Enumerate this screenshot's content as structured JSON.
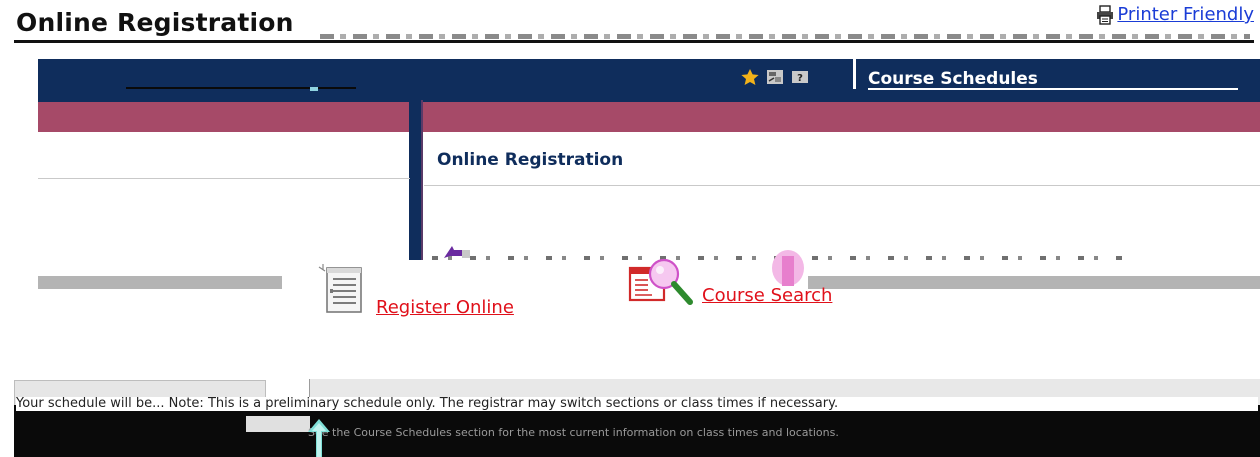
{
  "header": {
    "page_title": "Online Registration",
    "printer_link": "Printer Friendly"
  },
  "nav": {
    "heading": "Course Schedules",
    "tools": [
      {
        "icon": "star-icon",
        "color": "#f2b21a"
      },
      {
        "icon": "settings-icon",
        "color": "#c9c9c9"
      },
      {
        "icon": "help-icon",
        "color": "#c9c9c9"
      }
    ],
    "colors": {
      "navy": "#0f2d5c",
      "maroon": "#a64a68"
    }
  },
  "content": {
    "heading": "Online Registration",
    "actions": [
      {
        "label": " Register Online",
        "icon": "registration-form-icon"
      },
      {
        "label": " Course Search",
        "icon": "magnifier-search-icon"
      }
    ],
    "link_color": "#e0101a"
  },
  "footer": {
    "note": "Your schedule will be...  Note: This is a preliminary schedule only. The registrar may switch sections or class times if necessary.",
    "note_detail": "See the Course Schedules section for the most current information on class times and locations."
  }
}
